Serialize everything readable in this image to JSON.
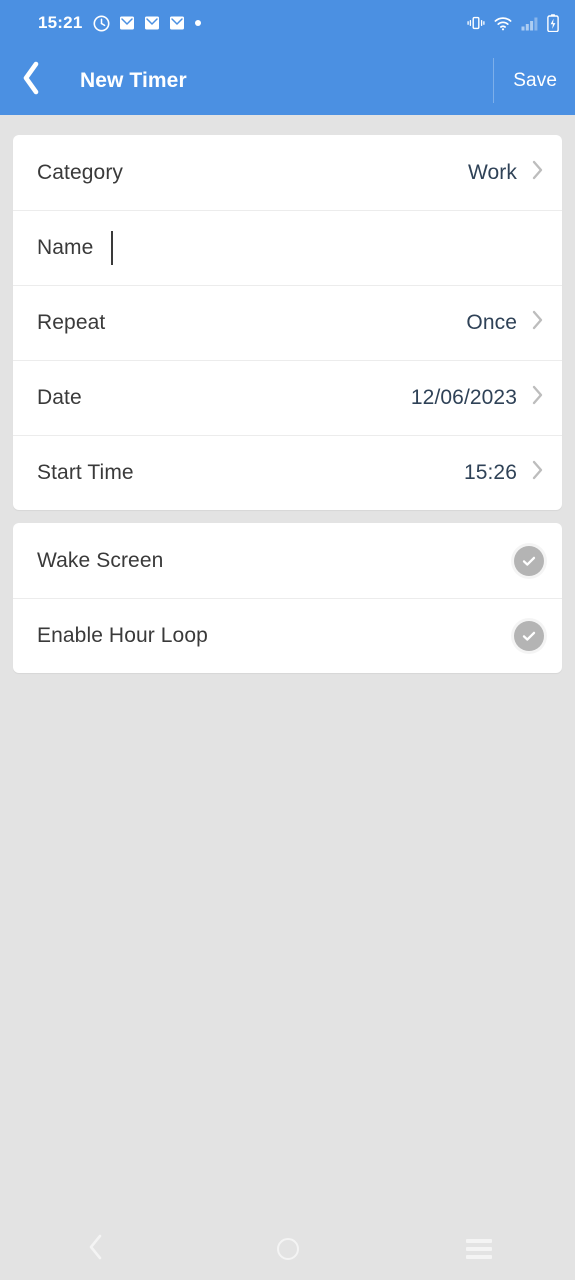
{
  "status_bar": {
    "clock": "15:21",
    "left_icons": [
      "stopwatch-icon",
      "mail-icon",
      "mail-icon",
      "mail-icon",
      "dot-icon"
    ],
    "right_icons": [
      "vibrate-icon",
      "wifi-icon",
      "signal-icon",
      "battery-charging-icon"
    ],
    "background_color": "#4b90e2"
  },
  "app_bar": {
    "back_icon": "chevron-left-icon",
    "title": "New Timer",
    "save_label": "Save",
    "background_color": "#4b90e2",
    "text_color": "#ffffff"
  },
  "settings_card": {
    "rows": [
      {
        "label": "Category",
        "value": "Work",
        "accessory": "chevron-right-icon"
      },
      {
        "label": "Name",
        "value": "",
        "placeholder": "",
        "accessory": "text-cursor"
      },
      {
        "label": "Repeat",
        "value": "Once",
        "accessory": "chevron-right-icon"
      },
      {
        "label": "Date",
        "value": "12/06/2023",
        "accessory": "chevron-right-icon"
      },
      {
        "label": "Start Time",
        "value": "15:26",
        "accessory": "chevron-right-icon"
      }
    ]
  },
  "toggles_card": {
    "rows": [
      {
        "label": "Wake Screen",
        "accessory": "check-circle-icon",
        "checked": false
      },
      {
        "label": "Enable Hour Loop",
        "accessory": "check-circle-icon",
        "checked": false
      }
    ]
  },
  "nav_bar": {
    "back_icon": "chevron-left-icon",
    "home_icon": "circle-home-icon",
    "recents_icon": "hamburger-recents-icon"
  },
  "colors": {
    "accent": "#4b90e2",
    "page_background": "#e3e3e3",
    "card_background": "#ffffff",
    "label_text": "#3a3a3a",
    "value_text": "#2f4257",
    "chevron": "#bdbdbd",
    "check_circle": "#b4b4b4"
  }
}
